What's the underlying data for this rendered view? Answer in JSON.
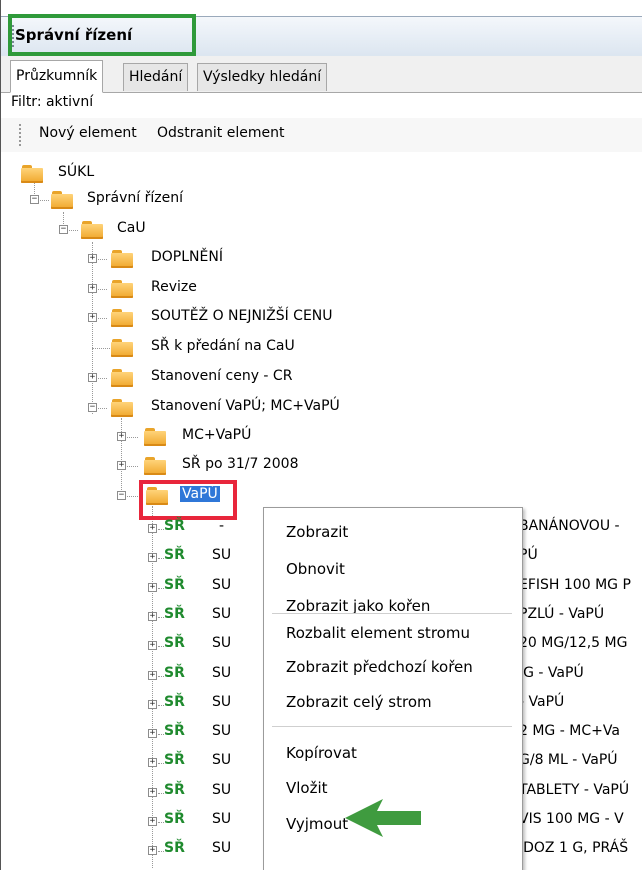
{
  "window": {
    "title": "Správní řízení"
  },
  "tabs": [
    {
      "label": "Průzkumník"
    },
    {
      "label": "Hledání"
    },
    {
      "label": "Výsledky hledání"
    }
  ],
  "filter": {
    "label": "Filtr: aktivní"
  },
  "toolbar": {
    "new_label": "Nový element",
    "delete_label": "Odstranit element"
  },
  "tree": {
    "root": "SÚKL",
    "spravni_rizeni": "Správní řízení",
    "cau": "CaU",
    "cau_children": [
      "DOPLNĚNÍ",
      "Revize",
      "SOUTĚŽ O NEJNIŽŠÍ CENU",
      "SŘ k předání na CaU",
      "Stanovení ceny - CR",
      "Stanovení VaPÚ; MC+VaPÚ"
    ],
    "stanoveni_children": [
      "MC+VaPÚ",
      "SŘ po 31/7 2008",
      "VaPÚ"
    ],
    "sr_icon": "SŘ",
    "sr_item_first": "-",
    "sr_item_prefix": "SU",
    "sr_item_tails": [
      "BANÁNOVOU - ",
      "PÚ",
      "EFISH 100 MG P",
      "PZLÚ - VaPÚ",
      "20 MG/12,5 MG",
      "IG - VaPÚ",
      "- VaPÚ",
      "2 MG - MC+Va",
      "G/8 ML - VaPÚ",
      "TABLETY - VaPÚ",
      "VIS 100 MG - V",
      "IDOZ 1 G, PRÁŠ"
    ]
  },
  "context_menu": {
    "items": [
      "Zobrazit",
      "Obnovit",
      "Zobrazit jako kořen",
      "Rozbalit element stromu",
      "Zobrazit předchozí kořen",
      "Zobrazit celý strom",
      "Kopírovat",
      "Vložit",
      "Vyjmout"
    ]
  },
  "colors": {
    "highlight_title": "#2f9a3a",
    "highlight_vapu": "#e8263b",
    "arrow": "#3f9b3f",
    "selection": "#2f77d8",
    "sr_icon": "#1f8a2e"
  },
  "icons": [
    "folder-icon",
    "expand-plus-icon",
    "collapse-minus-icon",
    "sr-record-icon",
    "arrow-pointer"
  ]
}
